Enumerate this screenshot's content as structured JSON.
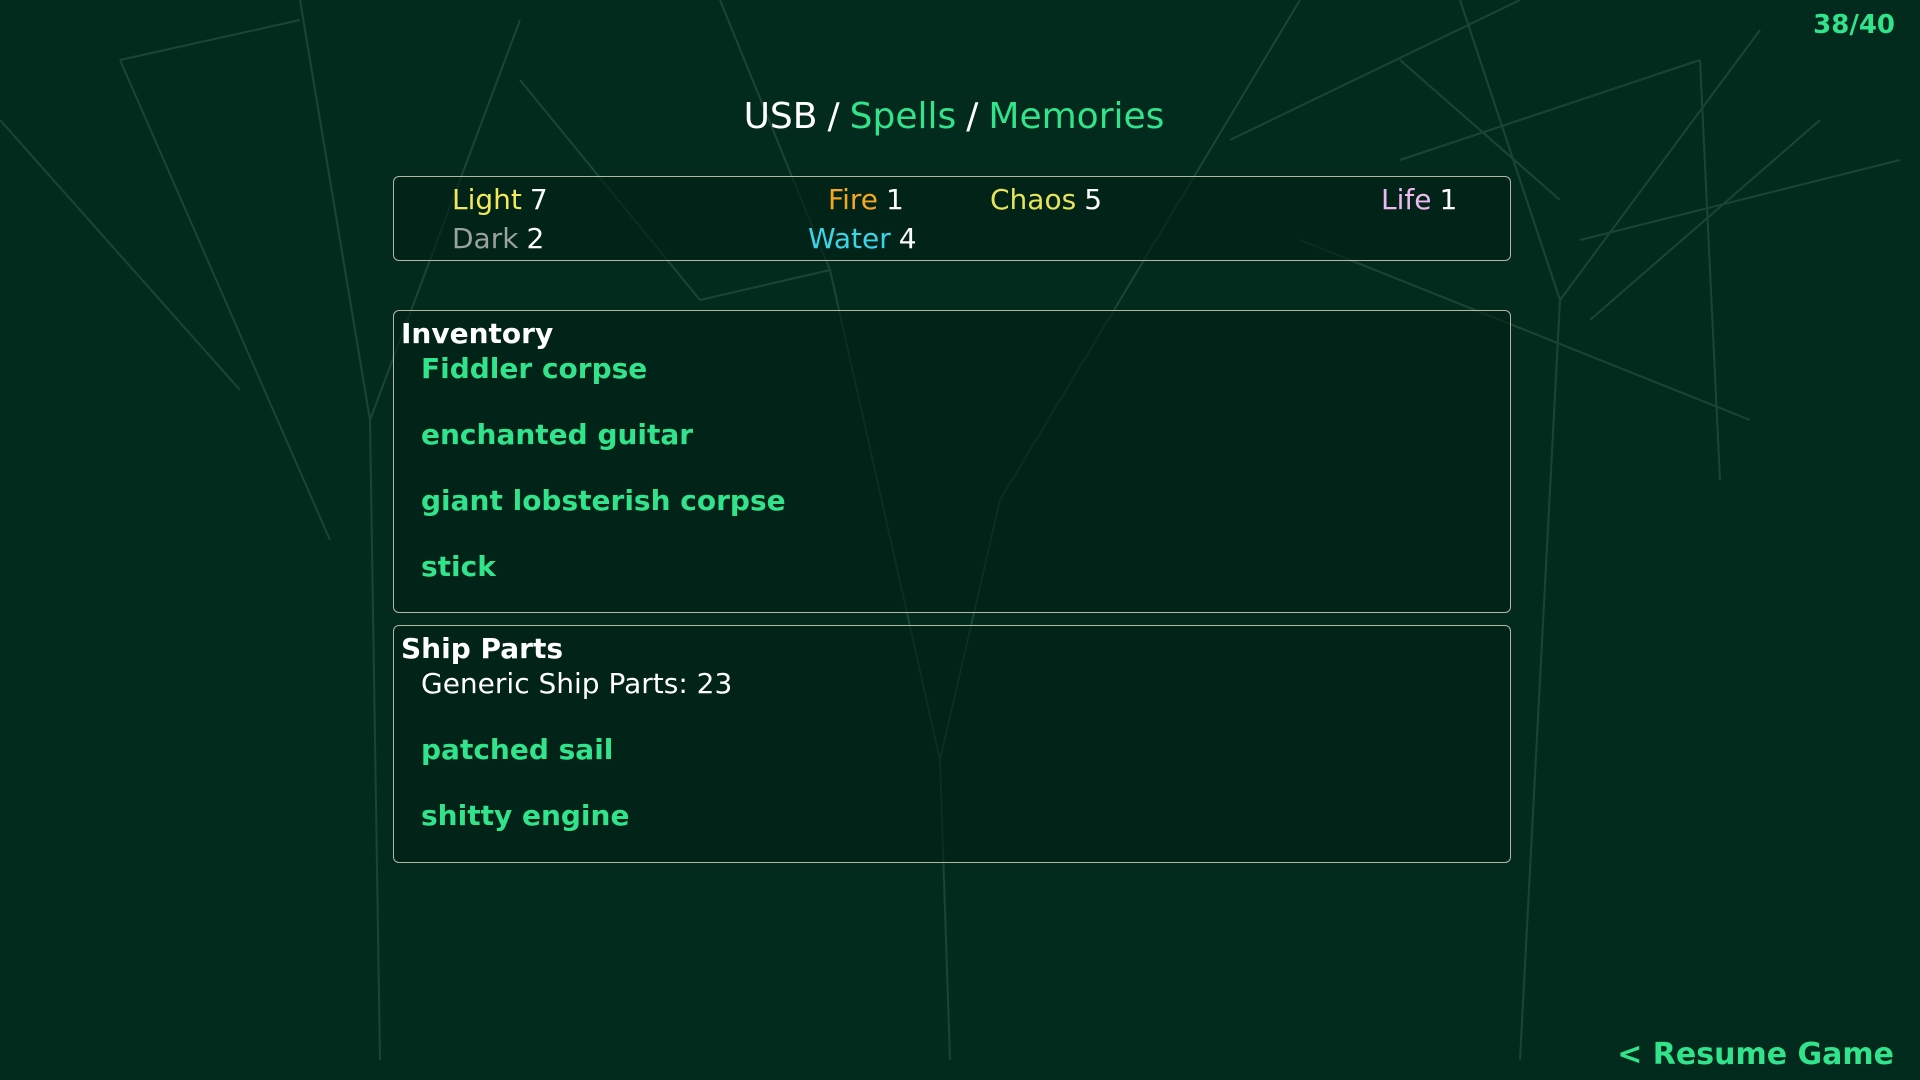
{
  "counter": "38/40",
  "breadcrumb": {
    "root": "USB",
    "separator": "/",
    "spells": "Spells",
    "memories": "Memories"
  },
  "elements": [
    {
      "name": "Light",
      "value": "7",
      "color": "#f2e85a"
    },
    {
      "name": "Fire",
      "value": "1",
      "color": "#f5a623"
    },
    {
      "name": "Chaos",
      "value": "5",
      "color": "#e8e45a"
    },
    {
      "name": "Life",
      "value": "1",
      "color": "#f0b8ef"
    },
    {
      "name": "Dark",
      "value": "2",
      "color": "#9aa29d"
    },
    {
      "name": "Water",
      "value": "4",
      "color": "#3ad6e8"
    }
  ],
  "inventory": {
    "title": "Inventory",
    "items": [
      "Fiddler corpse",
      "enchanted guitar",
      "giant lobsterish corpse",
      "stick"
    ]
  },
  "ship_parts": {
    "title": "Ship Parts",
    "generic": "Generic Ship Parts: 23",
    "items": [
      "patched sail",
      "shitty engine"
    ]
  },
  "resume_label": "< Resume Game",
  "colors": {
    "background": "#022b1e",
    "accent": "#31e38a",
    "panel_border": "#b3b7a6"
  }
}
